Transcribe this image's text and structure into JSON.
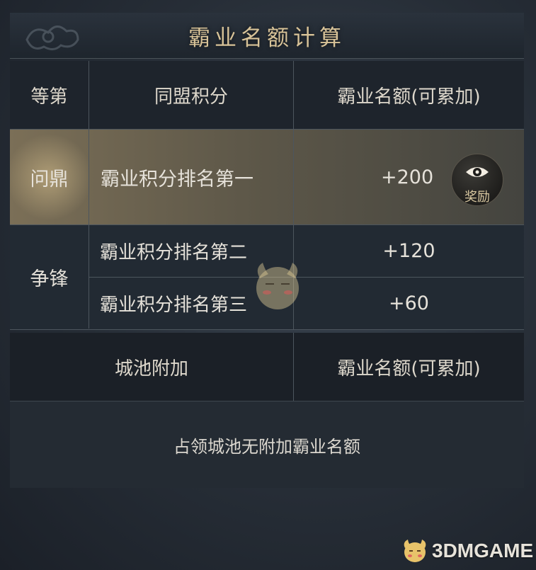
{
  "title": "霸业名额计算",
  "header": {
    "col_rank": "等第",
    "col_points": "同盟积分",
    "col_quota": "霸业名额(可累加)"
  },
  "rows": [
    {
      "rank": "问鼎",
      "criterion": "霸业积分排名第一",
      "quota": "+200"
    },
    {
      "rank": "争锋",
      "criterion": "霸业积分排名第二",
      "quota": "+120"
    },
    {
      "rank": "",
      "criterion": "霸业积分排名第三",
      "quota": "+60"
    }
  ],
  "reward_button": {
    "label": "奖励",
    "icon": "eye-icon"
  },
  "city_section": {
    "header_left": "城池附加",
    "header_right": "霸业名额(可累加)",
    "note": "占领城池无附加霸业名额"
  },
  "watermark": {
    "text": "3DMGAME"
  },
  "colors": {
    "title_gold": "#d8c398",
    "highlight_row": "#6e6450",
    "table_bg": "#222a33",
    "text": "#e6e2da"
  }
}
